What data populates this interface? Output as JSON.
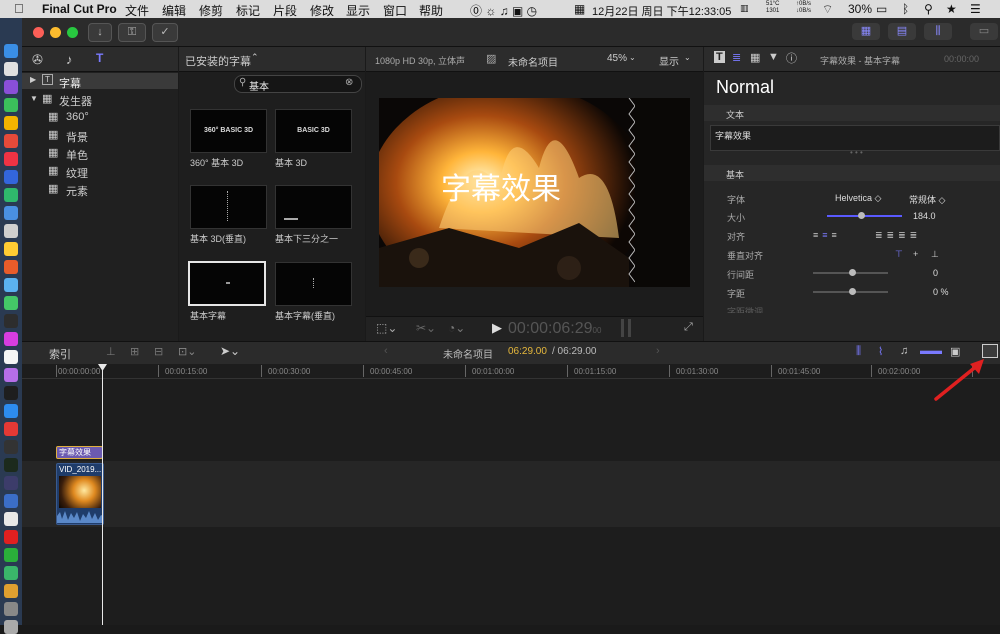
{
  "menubar": {
    "app": "Final Cut Pro",
    "items": [
      "文件",
      "编辑",
      "修剪",
      "标记",
      "片段",
      "修改",
      "显示",
      "窗口",
      "帮助"
    ],
    "temp": "51°C",
    "rpm": "1301",
    "net_up": "0B/s",
    "net_down": "0B/s",
    "battery": "30%",
    "datetime": "12月22日 周日 下午12:33:05"
  },
  "sidebar": {
    "items": [
      {
        "label": "字幕",
        "icon": "T"
      },
      {
        "label": "发生器"
      },
      {
        "label": "360°"
      },
      {
        "label": "背景"
      },
      {
        "label": "单色"
      },
      {
        "label": "纹理"
      },
      {
        "label": "元素"
      }
    ]
  },
  "browser": {
    "title": "已安装的字幕",
    "search_value": "基本",
    "thumbs": [
      {
        "art": "360° BASIC 3D",
        "caption": "360° 基本 3D"
      },
      {
        "art": "BASIC 3D",
        "caption": "基本 3D"
      },
      {
        "art": "",
        "caption": "基本 3D(垂直)"
      },
      {
        "art": "",
        "caption": "基本下三分之一"
      },
      {
        "art": "",
        "caption": "基本字幕"
      },
      {
        "art": "",
        "caption": "基本字幕(垂直)"
      }
    ]
  },
  "viewer": {
    "format": "1080p HD 30p, 立体声",
    "project": "未命名项目",
    "zoom": "45%",
    "display": "显示",
    "overlay_text": "字幕效果",
    "timecode_main": "00:00:06:29",
    "timecode_frames": "00"
  },
  "inspector": {
    "header": "字幕效果 - 基本字幕",
    "header_time": "00:00:00",
    "style_name": "Normal",
    "text_section": "文本",
    "text_value": "字幕效果",
    "basic_section": "基本",
    "rows": [
      {
        "label": "字体",
        "value": "Helvetica ◇",
        "value2": "常规体 ◇"
      },
      {
        "label": "大小",
        "value": "184.0"
      },
      {
        "label": "对齐",
        "value": ""
      },
      {
        "label": "垂直对齐",
        "value": ""
      },
      {
        "label": "行间距",
        "value": "0"
      },
      {
        "label": "字距",
        "value": "0 %"
      },
      {
        "label": "字距微调",
        "value": ""
      }
    ]
  },
  "timeline": {
    "index_label": "索引",
    "project": "未命名项目",
    "time_current": "06:29.00",
    "time_total": "/ 06:29.00",
    "ruler": [
      "00:00:00:00",
      "00:00:15:00",
      "00:00:30:00",
      "00:00:45:00",
      "00:01:00:00",
      "00:01:15:00",
      "00:01:30:00",
      "00:01:45:00",
      "00:02:00:00"
    ],
    "title_clip": "字幕效果",
    "video_clip": "VID_2019..."
  },
  "colors": {
    "accent_blue": "#7878ff",
    "title_clip": "#6b5ab0",
    "title_border": "#e0b040",
    "video_clip": "#1f3c6a",
    "arrow": "#e02020"
  }
}
